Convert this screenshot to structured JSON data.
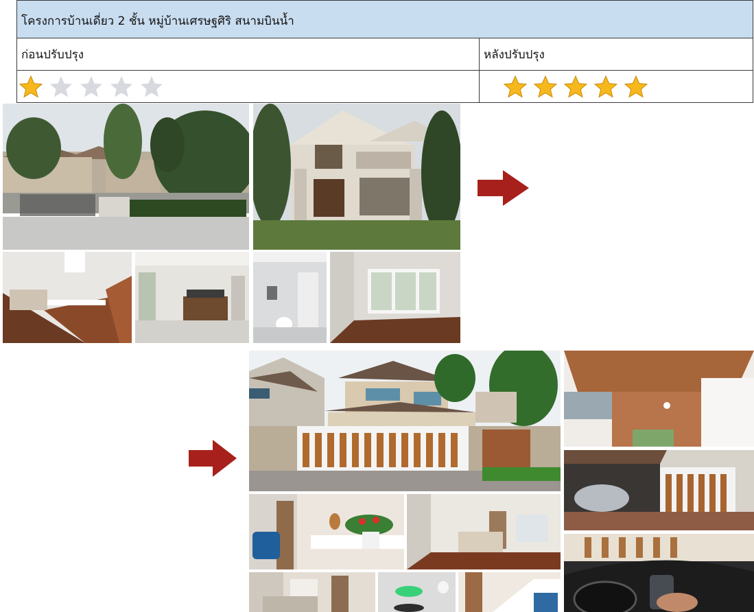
{
  "project": {
    "title": "โครงการบ้านเดี่ยว 2 ชั้น หมู่บ้านเศรษฐศิริ สนามบินน้ำ"
  },
  "columns": {
    "before": "ก่อนปรับปรุง",
    "after": "หลังปรับปรุง"
  },
  "rating": {
    "before": 1,
    "after": 5,
    "max": 5
  },
  "colors": {
    "header_bg": "#c9ddf0",
    "star_filled": "#f6b81c",
    "star_empty": "#d7d9df",
    "arrow": "#a8201b"
  },
  "icons": {
    "before_arrow": "right-arrow",
    "after_arrow": "right-arrow"
  }
}
